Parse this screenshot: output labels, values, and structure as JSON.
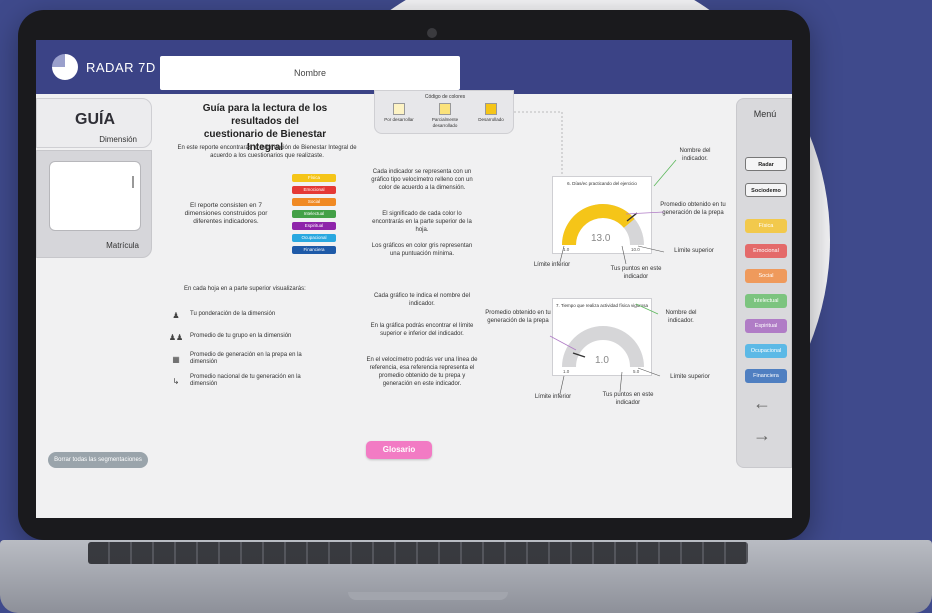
{
  "app": {
    "brand": "RADAR 7D",
    "name_placeholder": "Nombre"
  },
  "left": {
    "guia": "GUÍA",
    "dimension_label": "Dimensión",
    "matricula_label": "Matrícula",
    "clear_button": "Borrar todas las segmentaciones"
  },
  "doc": {
    "title_line1": "Guía para la lectura de los resultados del",
    "title_line2": "cuestionario de Bienestar Integral",
    "intro": "En este reporte encontrarás tu información de Bienestar Integral de acuerdo a los cuestionarios que realizaste.",
    "report": "El reporte consisten en 7 dimensiones construidos por diferentes indicadores.",
    "each_sheet": "En cada hoja en a parte superior visualizarás:",
    "legend": [
      {
        "icon": "person-icon",
        "text": "Tu ponderación de la dimensión"
      },
      {
        "icon": "group-icon",
        "text": "Promedio de tu grupo en la dimensión"
      },
      {
        "icon": "building-icon",
        "text": "Promedio de generación en la prepa en la dimensión"
      },
      {
        "icon": "trend-icon",
        "text": "Promedio nacional de tu generación en la dimensión"
      }
    ],
    "p_indicator": "Cada indicador se representa con un gráfico tipo velocímetro relleno con un color de acuerdo a la dimensión.",
    "p_meaning": "El significado de cada color lo encontrarás en la parte superior de la hoja.",
    "p_gray": "Los gráficos en color gris representan una puntuación mínima.",
    "p_name": "Cada gráfico te indica el nombre del indicador.",
    "p_limits": "En la gráfica podrás encontrar el límite superior e inferior del indicador.",
    "p_reference": "En el velocímetro podrás ver una línea de referencia, esa referencia representa el promedio obtenido de tu prepa y generación en este indicador.",
    "glosario": "Glosario"
  },
  "dimensions": [
    {
      "label": "Física",
      "color": "#f5c518"
    },
    {
      "label": "Emocional",
      "color": "#e53935"
    },
    {
      "label": "Social",
      "color": "#f08a24"
    },
    {
      "label": "Intelectual",
      "color": "#43a047"
    },
    {
      "label": "Espiritual",
      "color": "#8e24aa"
    },
    {
      "label": "Ocupacional",
      "color": "#29a8e0"
    },
    {
      "label": "Financiera",
      "color": "#1e5aa8"
    }
  ],
  "color_code": {
    "title": "Código de colores",
    "items": [
      {
        "label": "Por desarrollar",
        "color": "#fdf3c4"
      },
      {
        "label": "Parcialmente desarrollado",
        "color": "#fbe27a"
      },
      {
        "label": "Desarrollado",
        "color": "#f5c518"
      }
    ]
  },
  "gauges": [
    {
      "title": "6. Días/ec practicando del ejercicio",
      "value": "13.0",
      "min": "1.0",
      "max": "10.0",
      "fill_fraction": 0.78,
      "color": "#f5c518",
      "annotations": {
        "name": "Nombre del indicador.",
        "avg": "Promedio obtenido en tu generación de la prepa",
        "upper": "Límite superior",
        "points": "Tus puntos en este indicador",
        "lower": "Límite inferior"
      }
    },
    {
      "title": "7. Tiempo que realiza actividad física vigorosa",
      "value": "1.0",
      "min": "1.0",
      "max": "5.0",
      "fill_fraction": 0.0,
      "color": "#c9c9cc",
      "annotations": {
        "name": "Nombre del indicador.",
        "avg": "Promedio obtenido en tu generación de la prepa",
        "upper": "Límite superior",
        "points": "Tus puntos en este indicador",
        "lower": "Límite inferior"
      }
    }
  ],
  "menu": {
    "title": "Menú",
    "buttons": [
      "Radar",
      "Sociodemo"
    ],
    "dimensions": [
      {
        "label": "Física",
        "color": "#f2c94c"
      },
      {
        "label": "Emocional",
        "color": "#e46a6a"
      },
      {
        "label": "Social",
        "color": "#ef9a5c"
      },
      {
        "label": "Intelectual",
        "color": "#7cc47f"
      },
      {
        "label": "Espiritual",
        "color": "#b07cc6"
      },
      {
        "label": "Ocupacional",
        "color": "#5cb9e6"
      },
      {
        "label": "Financiera",
        "color": "#4f7fc1"
      }
    ],
    "back_icon": "arrow-left-icon",
    "forward_icon": "arrow-right-icon"
  }
}
